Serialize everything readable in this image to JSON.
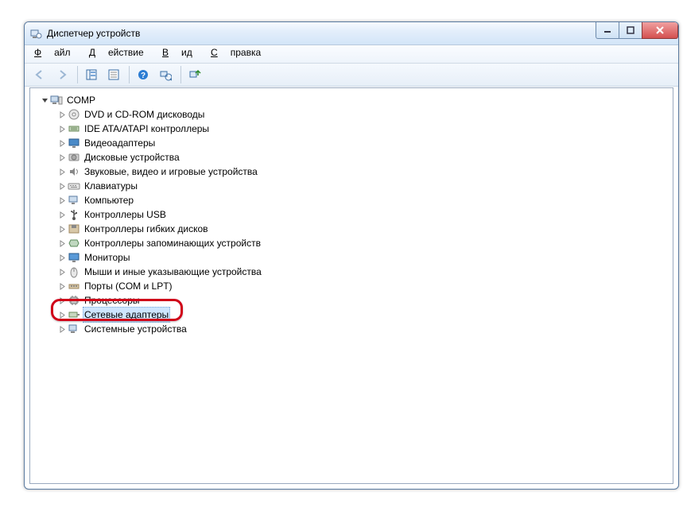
{
  "window": {
    "title": "Диспетчер устройств"
  },
  "menu": {
    "file": "Файл",
    "action": "Действие",
    "view": "Вид",
    "help": "Справка"
  },
  "tree": {
    "root": "COMP",
    "items": [
      {
        "label": "DVD и CD-ROM дисководы",
        "icon": "disc"
      },
      {
        "label": "IDE ATA/ATAPI контроллеры",
        "icon": "ide"
      },
      {
        "label": "Видеоадаптеры",
        "icon": "display"
      },
      {
        "label": "Дисковые устройства",
        "icon": "hdd"
      },
      {
        "label": "Звуковые, видео и игровые устройства",
        "icon": "sound"
      },
      {
        "label": "Клавиатуры",
        "icon": "keyboard"
      },
      {
        "label": "Компьютер",
        "icon": "computer"
      },
      {
        "label": "Контроллеры USB",
        "icon": "usb"
      },
      {
        "label": "Контроллеры гибких дисков",
        "icon": "floppyctl"
      },
      {
        "label": "Контроллеры запоминающих устройств",
        "icon": "storage"
      },
      {
        "label": "Мониторы",
        "icon": "monitor"
      },
      {
        "label": "Мыши и иные указывающие устройства",
        "icon": "mouse"
      },
      {
        "label": "Порты (COM и LPT)",
        "icon": "port"
      },
      {
        "label": "Процессоры",
        "icon": "cpu"
      },
      {
        "label": "Сетевые адаптеры",
        "icon": "network",
        "selected": true
      },
      {
        "label": "Системные устройства",
        "icon": "system"
      }
    ]
  }
}
